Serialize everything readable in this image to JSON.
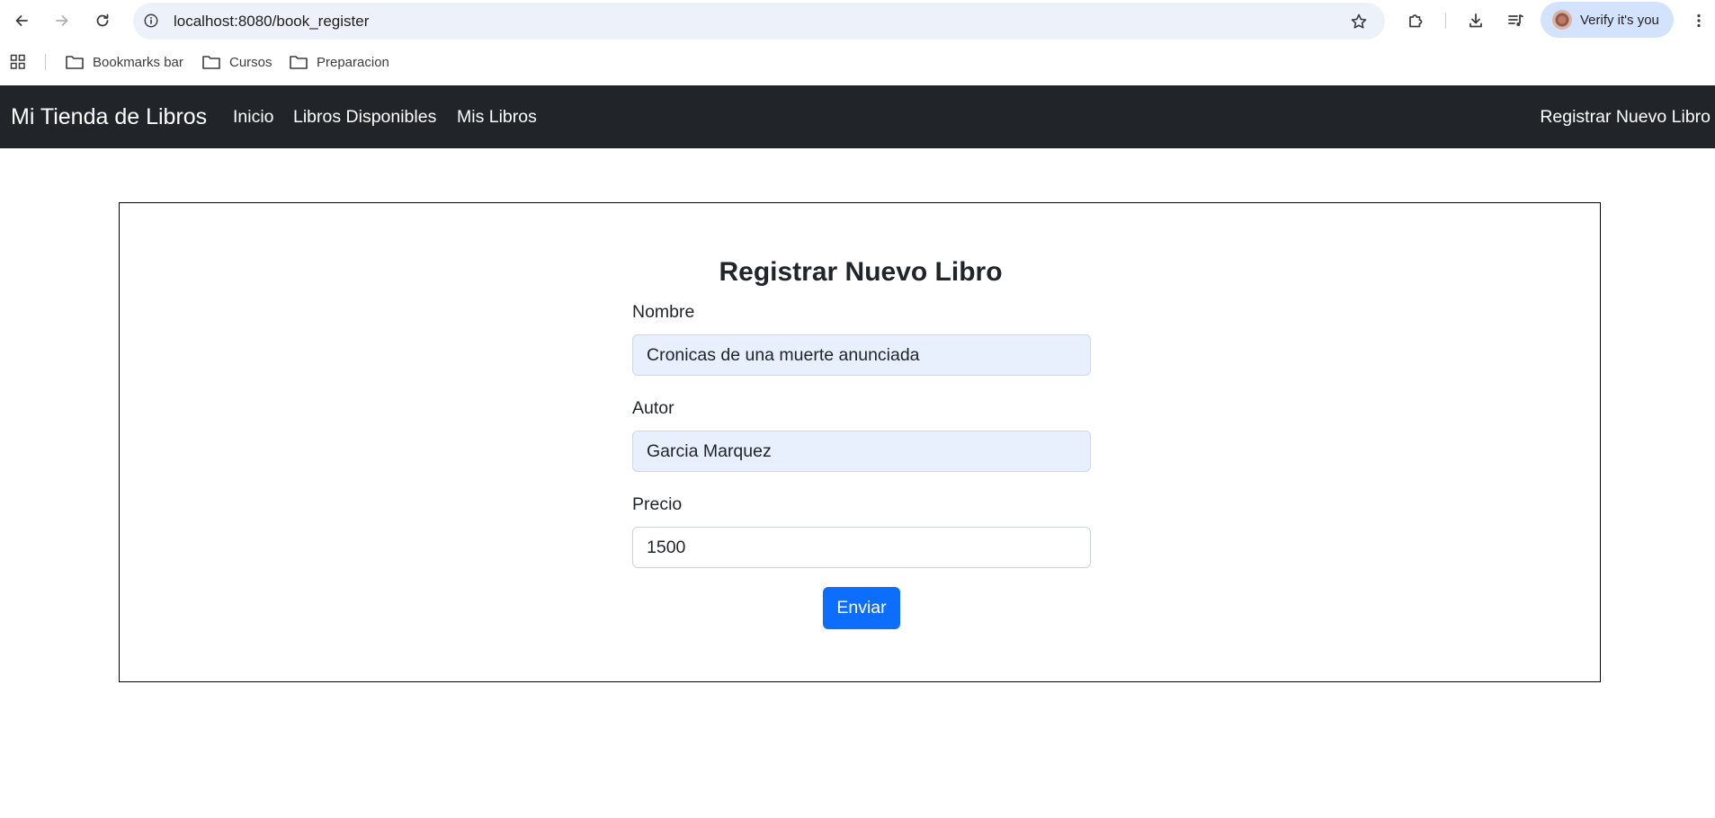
{
  "browser": {
    "url": "localhost:8080/book_register",
    "profile_label": "Verify it's you",
    "bookmarks": [
      {
        "label": "Bookmarks bar"
      },
      {
        "label": "Cursos"
      },
      {
        "label": "Preparacion"
      }
    ]
  },
  "navbar": {
    "brand": "Mi Tienda de Libros",
    "links": [
      {
        "label": "Inicio"
      },
      {
        "label": "Libros Disponibles"
      },
      {
        "label": "Mis Libros"
      }
    ],
    "right_link": "Registrar Nuevo Libro"
  },
  "form": {
    "title": "Registrar Nuevo Libro",
    "fields": [
      {
        "label": "Nombre",
        "value": "Cronicas de una muerte anunciada"
      },
      {
        "label": "Autor",
        "value": "Garcia Marquez"
      },
      {
        "label": "Precio",
        "value": "1500"
      }
    ],
    "submit_label": "Enviar"
  },
  "colors": {
    "navbar_bg": "#212529",
    "primary": "#0d6efd",
    "autofill_bg": "#e8f0fe"
  }
}
